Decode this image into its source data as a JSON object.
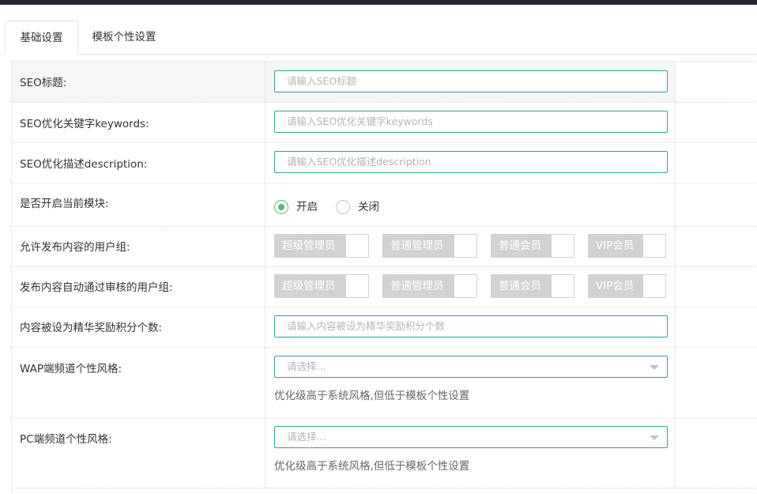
{
  "tabs": [
    {
      "label": "基础设置",
      "active": true
    },
    {
      "label": "模板个性设置",
      "active": false
    }
  ],
  "form": {
    "seo_title": {
      "label": "SEO标题:",
      "placeholder": "请输入SEO标题"
    },
    "seo_keywords": {
      "label": "SEO优化关键字keywords:",
      "placeholder": "请输入SEO优化关键字keywords"
    },
    "seo_description": {
      "label": "SEO优化描述description:",
      "placeholder": "请输入SEO优化描述description"
    },
    "module_enable": {
      "label": "是否开启当前模块:",
      "options": [
        {
          "label": "开启",
          "checked": true
        },
        {
          "label": "关闭",
          "checked": false
        }
      ]
    },
    "publish_groups": {
      "label": "允许发布内容的用户组:",
      "options": [
        "超级管理员",
        "普通管理员",
        "普通会员",
        "VIP会员"
      ]
    },
    "auto_approve_groups": {
      "label": "发布内容自动通过审核的用户组:",
      "options": [
        "超级管理员",
        "普通管理员",
        "普通会员",
        "VIP会员"
      ]
    },
    "featured_points": {
      "label": "内容被设为精华奖励积分个数:",
      "placeholder": "请输入内容被设为精华奖励积分个数"
    },
    "wap_style": {
      "label": "WAP端频道个性风格:",
      "selected": "请选择...",
      "hint": "优化级高于系统风格,但低于模板个性设置"
    },
    "pc_style": {
      "label": "PC端频道个性风格:",
      "selected": "请选择...",
      "hint": "优化级高于系统风格,但低于模板个性设置"
    }
  },
  "colors": {
    "accent": "#3a9da3",
    "radio_checked": "#5fb878",
    "checkbox_bg": "#d2d2d2",
    "topbar": "#23262e"
  }
}
